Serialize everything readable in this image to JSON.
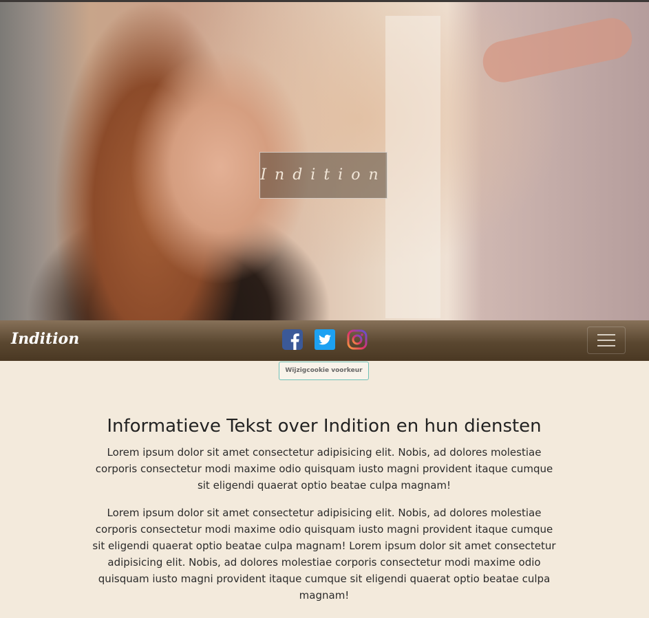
{
  "hero": {
    "logo_text": "Indition"
  },
  "navbar": {
    "brand": "Indition",
    "social": [
      {
        "icon": "facebook-icon",
        "color": "#3b5998"
      },
      {
        "icon": "twitter-icon",
        "color": "#1da1f2"
      },
      {
        "icon": "instagram-icon",
        "color": "#c13584"
      }
    ]
  },
  "cookie": {
    "label": "Wijzigcookie voorkeur"
  },
  "main": {
    "heading": "Informatieve Tekst over Indition en hun diensten",
    "paragraphs": [
      "Lorem ipsum dolor sit amet consectetur adipisicing elit. Nobis, ad dolores molestiae corporis consectetur modi maxime odio quisquam iusto magni provident itaque cumque sit eligendi quaerat optio beatae culpa magnam!",
      "Lorem ipsum dolor sit amet consectetur adipisicing elit. Nobis, ad dolores molestiae corporis consectetur modi maxime odio quisquam iusto magni provident itaque cumque sit eligendi quaerat optio beatae culpa magnam! Lorem ipsum dolor sit amet consectetur adipisicing elit. Nobis, ad dolores molestiae corporis consectetur modi maxime odio quisquam iusto magni provident itaque cumque sit eligendi quaerat optio beatae culpa magnam!"
    ]
  }
}
